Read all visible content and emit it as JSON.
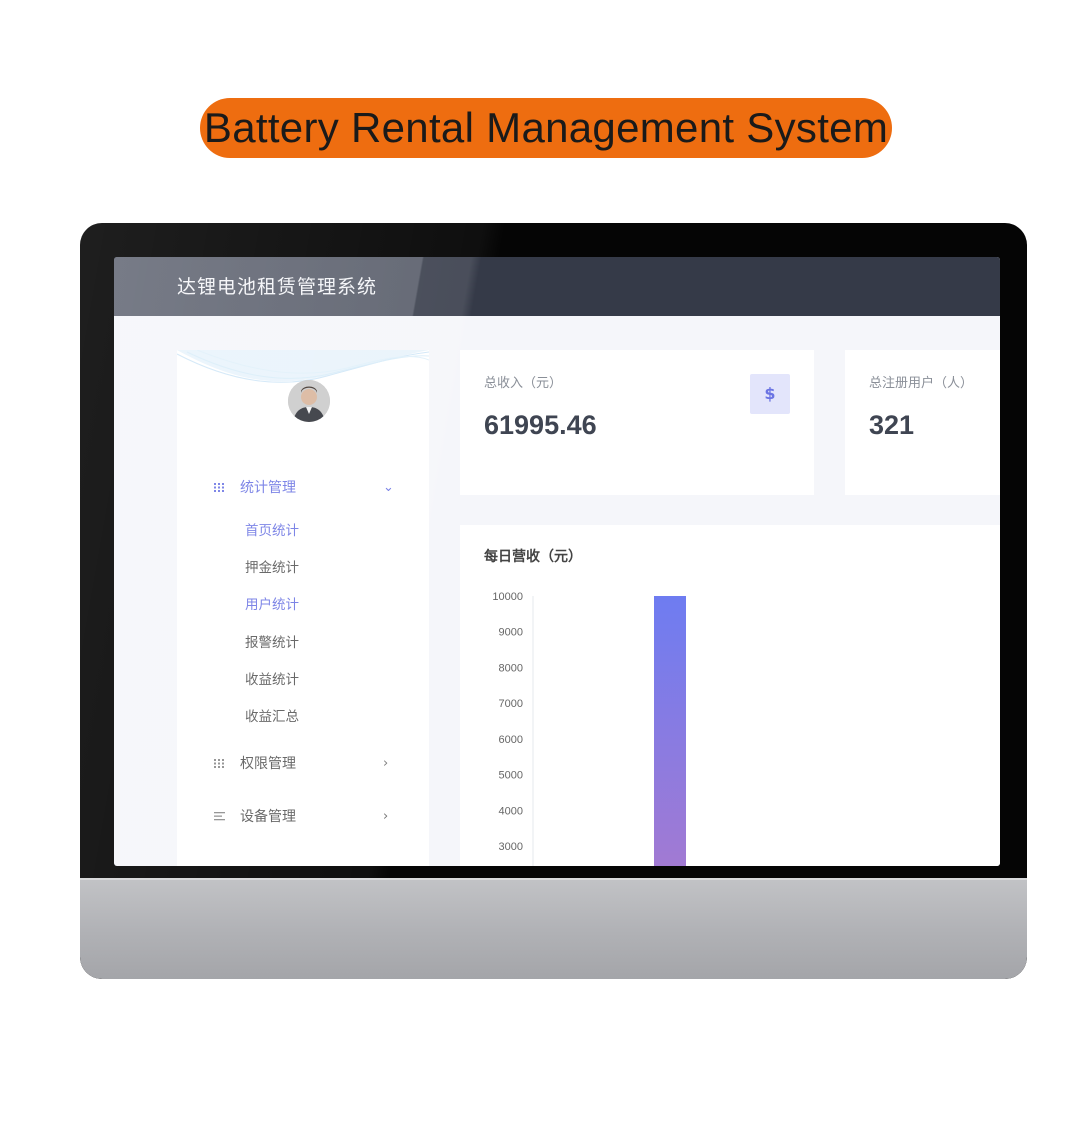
{
  "banner": {
    "title": "Battery Rental Management System"
  },
  "app": {
    "title": "达锂电池租赁管理系统"
  },
  "sidebar": {
    "avatar_icon": "user-avatar",
    "groups": [
      {
        "label": "统计管理",
        "icon": "grid-dots-icon",
        "expanded": true,
        "active": true,
        "items": [
          {
            "label": "首页统计",
            "active": true
          },
          {
            "label": "押金统计",
            "active": false
          },
          {
            "label": "用户统计",
            "active": true
          },
          {
            "label": "报警统计",
            "active": false
          },
          {
            "label": "收益统计",
            "active": false
          },
          {
            "label": "收益汇总",
            "active": false
          }
        ]
      },
      {
        "label": "权限管理",
        "icon": "grid-dots-icon",
        "expanded": false
      },
      {
        "label": "设备管理",
        "icon": "list-lines-icon",
        "expanded": false
      }
    ]
  },
  "cards": [
    {
      "label": "总收入（元）",
      "value": "61995.46",
      "badge": "$"
    },
    {
      "label": "总注册用户（人）",
      "value": "321"
    }
  ],
  "chart_data": {
    "type": "bar",
    "title": "每日营收（元）",
    "ylim": [
      3000,
      10000
    ],
    "yticks": [
      10000,
      9000,
      8000,
      7000,
      6000,
      5000,
      4000,
      3000
    ],
    "series": [
      {
        "values": [
          10000
        ]
      }
    ],
    "bar_color_top": "#6e7cf1",
    "bar_color_bottom": "#a57ad1",
    "grid": false
  },
  "colors": {
    "accent": "#6b74e3",
    "banner": "#ee6d10",
    "topbar": "#353a48"
  }
}
